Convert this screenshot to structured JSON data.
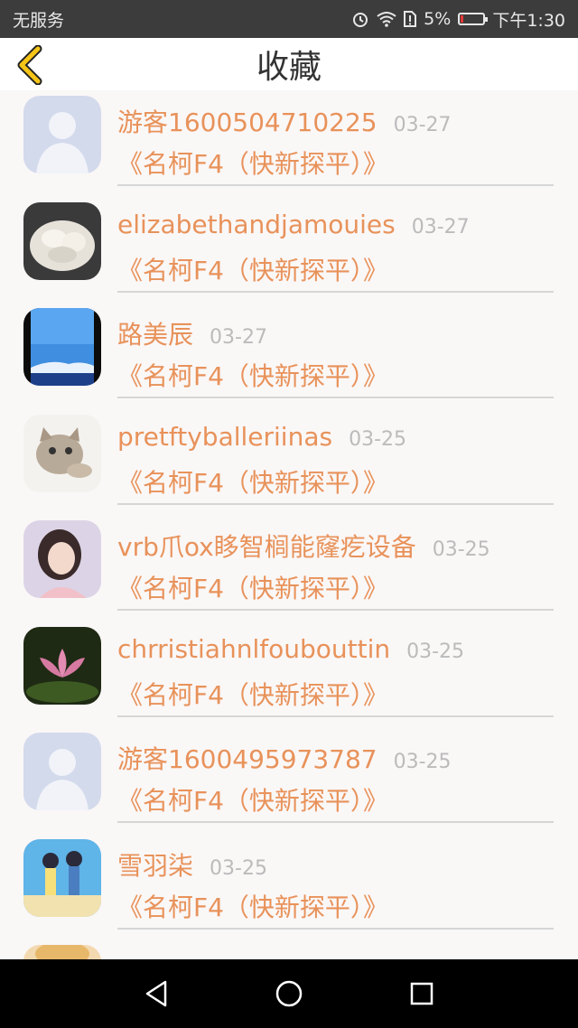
{
  "status_bar": {
    "carrier": "无服务",
    "battery": "5%",
    "time": "下午1:30",
    "battery_color": "#e53935"
  },
  "header": {
    "title": "收藏",
    "back_icon": "chevron-left-icon",
    "accent": "#f5c518"
  },
  "colors": {
    "name": "#e8925a",
    "date": "#bbbbbb",
    "background": "#faf7f7"
  },
  "favorites": [
    {
      "name": "游客1600504710225",
      "date": "03-27",
      "subtitle": "《名柯F4（快新探平）》",
      "avatar": "default-person"
    },
    {
      "name": "elizabethandjamouies",
      "date": "03-27",
      "subtitle": "《名柯F4（快新探平）》",
      "avatar": "white-flower-photo"
    },
    {
      "name": "路美辰",
      "date": "03-27",
      "subtitle": "《名柯F4（快新探平）》",
      "avatar": "sky-photo"
    },
    {
      "name": "pretftyballeriinas",
      "date": "03-25",
      "subtitle": "《名柯F4（快新探平）》",
      "avatar": "kitten-photo"
    },
    {
      "name": "vrb爪ox眵智榈能窿疙设备",
      "date": "03-25",
      "subtitle": "《名柯F4（快新探平）》",
      "avatar": "girl-photo"
    },
    {
      "name": "chrristiahnlfoubouttin",
      "date": "03-25",
      "subtitle": "《名柯F4（快新探平）》",
      "avatar": "lotus-photo"
    },
    {
      "name": "游客1600495973787",
      "date": "03-25",
      "subtitle": "《名柯F4（快新探平）》",
      "avatar": "default-person"
    },
    {
      "name": "雪羽柒",
      "date": "03-25",
      "subtitle": "《名柯F4（快新探平）》",
      "avatar": "anime-couple-photo"
    }
  ],
  "nav_bar": {
    "back": "triangle-back-icon",
    "home": "circle-home-icon",
    "recents": "square-recents-icon"
  }
}
